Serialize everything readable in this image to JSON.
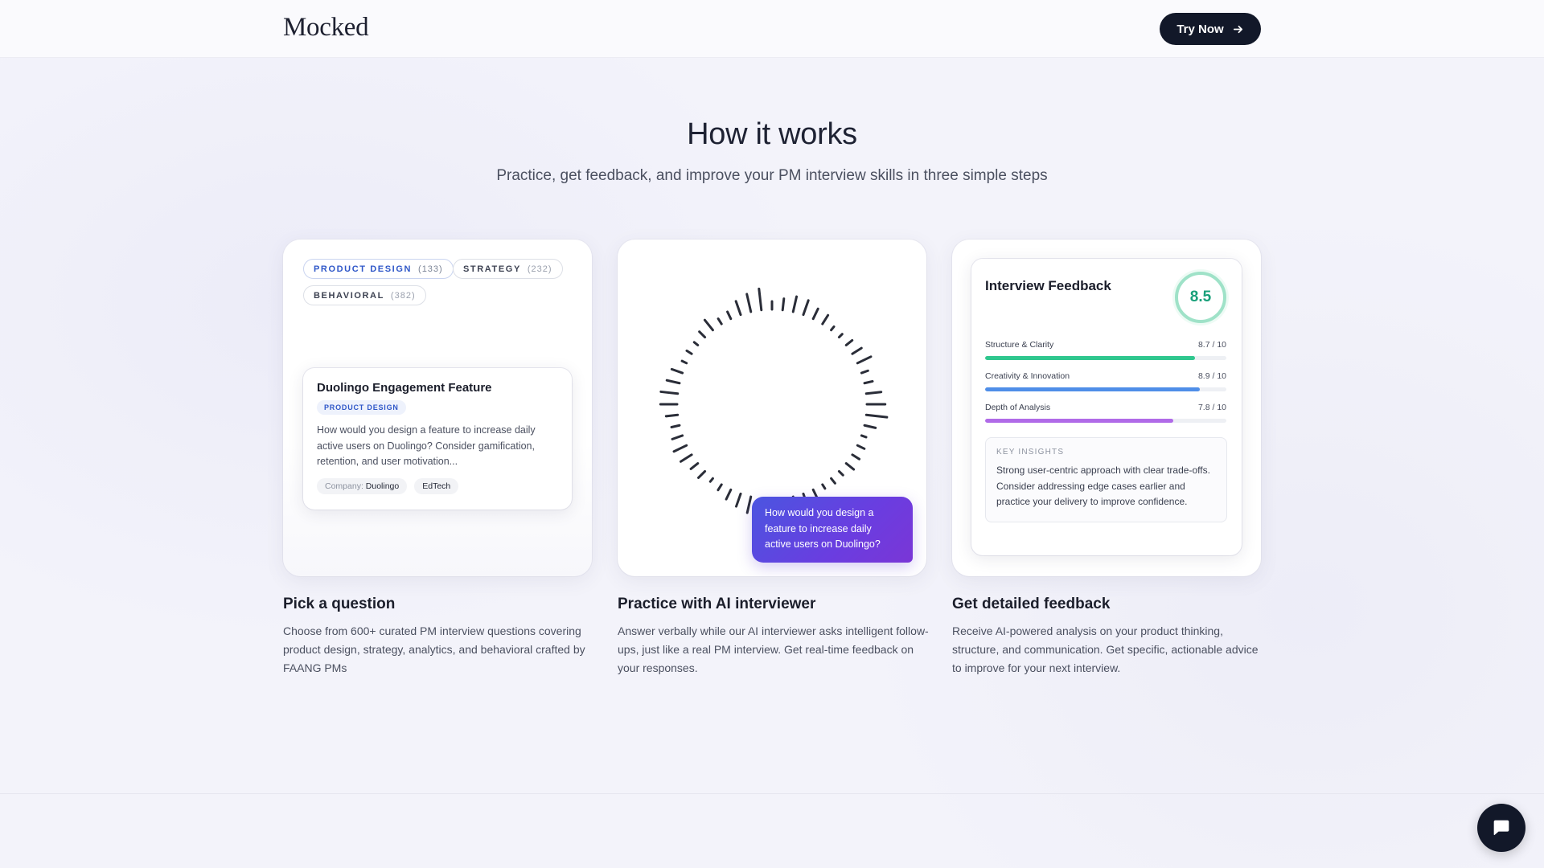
{
  "header": {
    "logo": "Mocked",
    "cta_label": "Try Now"
  },
  "section": {
    "title": "How it works",
    "subtitle": "Practice, get feedback, and improve your PM interview skills in three simple steps"
  },
  "card1": {
    "categories": [
      {
        "label": "PRODUCT DESIGN",
        "count": "(133)",
        "active": true
      },
      {
        "label": "STRATEGY",
        "count": "(232)",
        "active": false
      },
      {
        "label": "BEHAVIORAL",
        "count": "(382)",
        "active": false
      }
    ],
    "question": {
      "title": "Duolingo Engagement Feature",
      "tag": "PRODUCT DESIGN",
      "text": "How would you design a feature to increase daily active users on Duolingo? Consider gamification, retention, and user motivation...",
      "company_label": "Company:",
      "company": "Duolingo",
      "industry": "EdTech"
    }
  },
  "card2": {
    "bubble_text": "How would you design a feature to increase daily active users on Duolingo?"
  },
  "card3": {
    "title": "Interview Feedback",
    "score": "8.5",
    "metrics": [
      {
        "label": "Structure & Clarity",
        "value": "8.7 / 10",
        "fraction": 0.87,
        "color": "#2fc78e"
      },
      {
        "label": "Creativity & Innovation",
        "value": "8.9 / 10",
        "fraction": 0.89,
        "color": "#4f8ee8"
      },
      {
        "label": "Depth of Analysis",
        "value": "7.8 / 10",
        "fraction": 0.78,
        "color": "#b06ae8"
      }
    ],
    "insights_label": "KEY INSIGHTS",
    "insights_text": "Strong user-centric approach with clear trade-offs. Consider addressing edge cases earlier and practice your delivery to improve confidence."
  },
  "steps": [
    {
      "title": "Pick a question",
      "desc": "Choose from 600+ curated PM interview questions covering product design, strategy, analytics, and behavioral crafted by FAANG PMs"
    },
    {
      "title": "Practice with AI interviewer",
      "desc": "Answer verbally while our AI interviewer asks intelligent follow-ups, just like a real PM interview. Get real-time feedback on your responses."
    },
    {
      "title": "Get detailed feedback",
      "desc": "Receive AI-powered analysis on your product thinking, structure, and communication. Get specific, actionable advice to improve for your next interview."
    }
  ],
  "icons": {
    "cta": "arrow-right-icon",
    "chat": "chat-bubble-icon"
  }
}
